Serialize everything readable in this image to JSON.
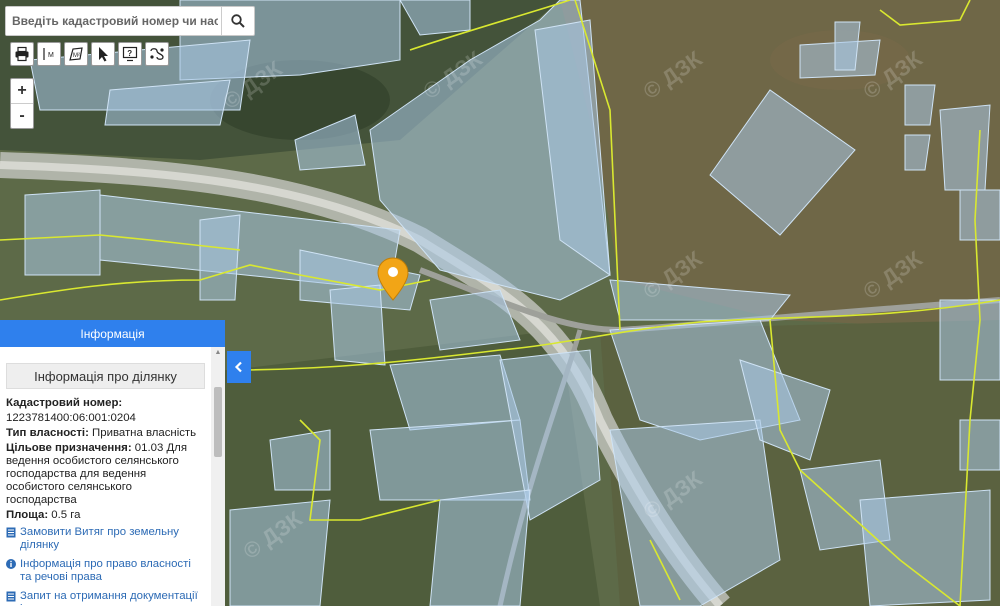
{
  "search": {
    "placeholder": "Введіть кадастровий номер чи населе"
  },
  "toolbar": {
    "tools": [
      "printer-icon",
      "measure-line-icon",
      "measure-area-icon",
      "cursor-icon",
      "help-icon",
      "layers-icon"
    ]
  },
  "zoom": {
    "in_label": "+",
    "out_label": "-"
  },
  "watermark": "© ДЗК",
  "panel": {
    "header": "Інформація",
    "section_title": "Інформація про ділянку",
    "cadastral_label": "Кадастровий номер:",
    "cadastral_value": "1223781400:06:001:0204",
    "ownership_label": "Тип власності:",
    "ownership_value": " Приватна власність",
    "purpose_label": "Цільове призначення:",
    "purpose_value": " 01.03 Для ведення особистого селянського господарства для ведення особистого селянського господарства",
    "area_label": "Площа:",
    "area_value": " 0.5 га",
    "links": [
      "Замовити Витяг про земельну ділянку",
      "Інформація про право власності та речові права",
      "Запит на отримання документації із землеустрою"
    ]
  },
  "colors": {
    "accent": "#2f80ed",
    "parcel_fill": "#a9c8e6",
    "boundary": "#d9e830",
    "marker": "#f2a516"
  }
}
